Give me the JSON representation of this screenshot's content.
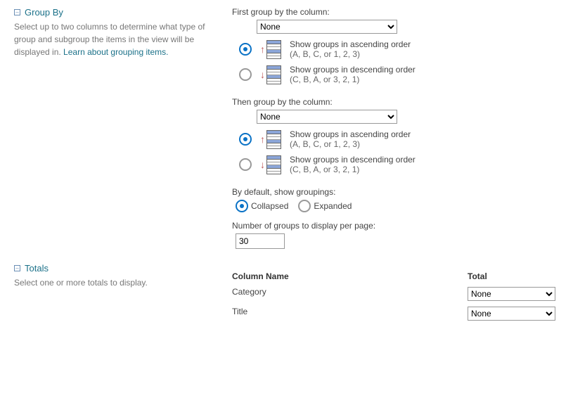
{
  "groupBy": {
    "title": "Group By",
    "description": "Select up to two columns to determine what type of group and subgroup the items in the view will be displayed in. ",
    "learnLink": "Learn about grouping items.",
    "first": {
      "label": "First group by the column:",
      "selected": "None",
      "asc": {
        "title": "Show groups in ascending order",
        "sub": "(A, B, C, or 1, 2, 3)"
      },
      "desc": {
        "title": "Show groups in descending order",
        "sub": "(C, B, A, or 3, 2, 1)"
      }
    },
    "then": {
      "label": "Then group by the column:",
      "selected": "None",
      "asc": {
        "title": "Show groups in ascending order",
        "sub": "(A, B, C, or 1, 2, 3)"
      },
      "desc": {
        "title": "Show groups in descending order",
        "sub": "(C, B, A, or 3, 2, 1)"
      }
    },
    "defaultLabel": "By default, show groupings:",
    "collapsed": "Collapsed",
    "expanded": "Expanded",
    "perPageLabel": "Number of groups to display per page:",
    "perPageValue": "30"
  },
  "totals": {
    "title": "Totals",
    "description": "Select one or more totals to display.",
    "columnHeader": "Column Name",
    "totalHeader": "Total",
    "rows": [
      {
        "name": "Category",
        "value": "None"
      },
      {
        "name": "Title",
        "value": "None"
      }
    ]
  }
}
